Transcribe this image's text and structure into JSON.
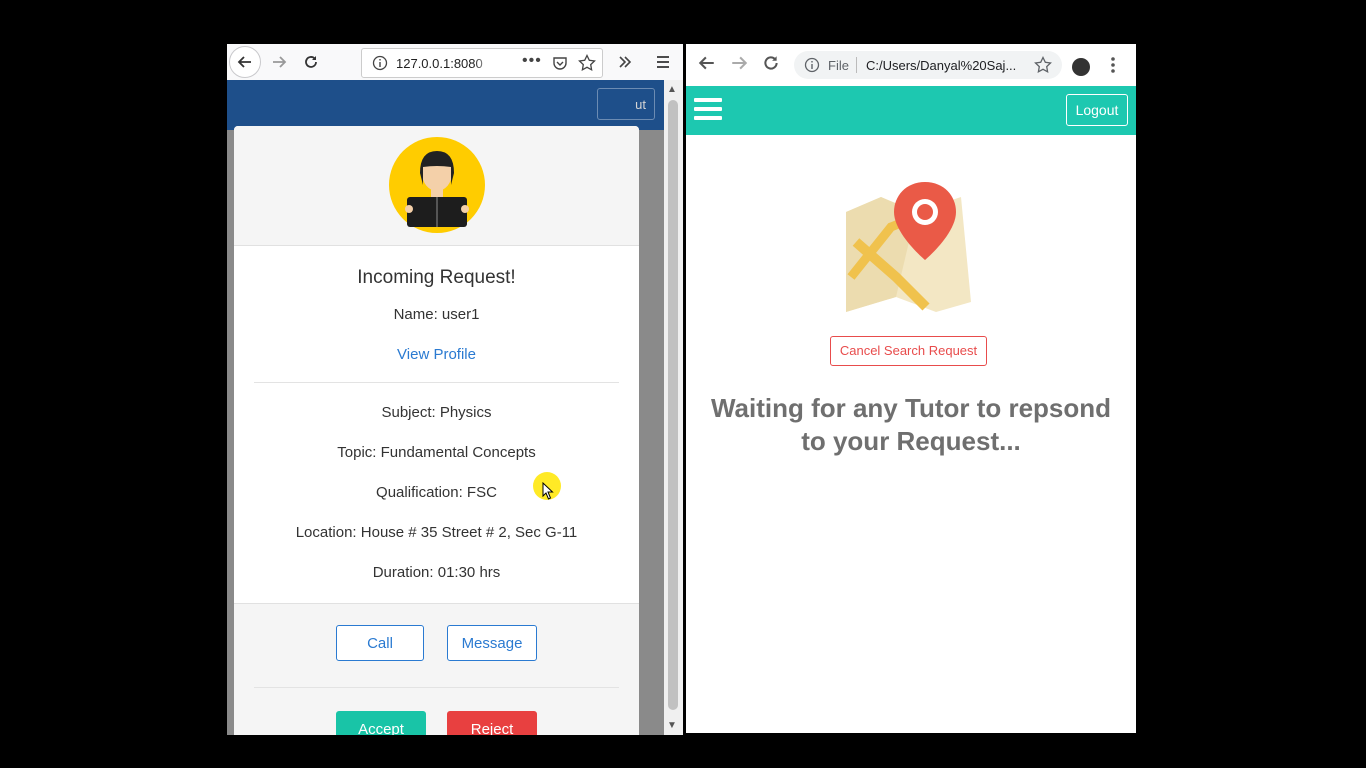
{
  "left_browser": {
    "url": "127.0.0.1:8080",
    "page_nav": {
      "logout_label": "ut"
    },
    "modal": {
      "title": "Incoming Request!",
      "name": "Name: user1",
      "view_profile": "View Profile",
      "details": [
        "Subject: Physics",
        "Topic: Fundamental Concepts",
        "Qualification: FSC",
        "Location: House # 35 Street # 2, Sec G-11",
        "Duration: 01:30 hrs"
      ],
      "buttons": {
        "call": "Call",
        "message": "Message",
        "accept": "Accept",
        "reject": "Reject"
      }
    }
  },
  "right_browser": {
    "file_label": "File",
    "url": "C:/Users/Danyal%20Saj...",
    "nav": {
      "logout": "Logout"
    },
    "cancel_label": "Cancel Search Request",
    "waiting_line1": "Waiting for any Tutor to repsond",
    "waiting_line2": "to your Request..."
  },
  "colors": {
    "teal": "#1dc8b0",
    "accept": "#19c4a7",
    "reject": "#e84040",
    "link": "#2a7ad1",
    "cancel": "#e84c4c",
    "avatar_bg": "#ffcc00"
  },
  "icons": [
    "back-icon",
    "forward-icon",
    "reload-icon",
    "info-icon",
    "more-icon",
    "pocket-icon",
    "star-icon",
    "overflow-icon",
    "menu-icon",
    "hamburger-icon",
    "map-pin-icon",
    "student-avatar"
  ]
}
